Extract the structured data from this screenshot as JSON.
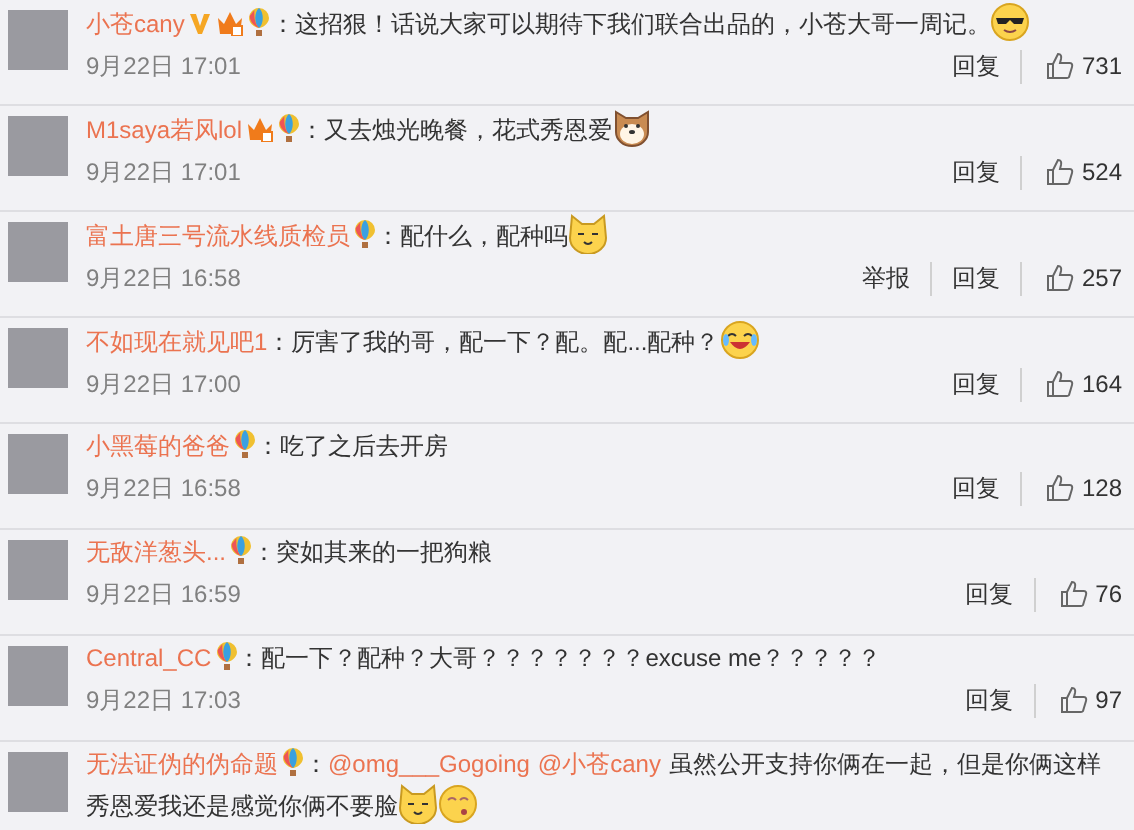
{
  "comments": [
    {
      "name": "小苍cany",
      "badges": [
        {
          "kind": "verified"
        },
        {
          "kind": "vip"
        },
        {
          "kind": "balloon"
        }
      ],
      "content": [
        {
          "kind": "plain",
          "text": "：这招狠！话说大家可以期待下我们联合出品的，小苍大哥一周记。"
        }
      ],
      "emojis": [
        {
          "kind": "cool"
        }
      ],
      "time": "9月22日 17:01",
      "actions": [
        "回复"
      ],
      "likes": "731"
    },
    {
      "name": "M1saya若风lol",
      "badges": [
        {
          "kind": "vip"
        },
        {
          "kind": "balloon"
        }
      ],
      "content": [
        {
          "kind": "plain",
          "text": "：又去烛光晚餐，花式秀恩爱"
        }
      ],
      "emojis": [
        {
          "kind": "dog"
        }
      ],
      "time": "9月22日 17:01",
      "actions": [
        "回复"
      ],
      "likes": "524"
    },
    {
      "name": "富土唐三号流水线质检员",
      "badges": [
        {
          "kind": "balloon"
        }
      ],
      "content": [
        {
          "kind": "plain",
          "text": "：配什么，配种吗"
        }
      ],
      "emojis": [
        {
          "kind": "cat"
        }
      ],
      "time": "9月22日 16:58",
      "actions": [
        "举报",
        "回复"
      ],
      "likes": "257"
    },
    {
      "name": "不如现在就见吧1",
      "content": [
        {
          "kind": "plain",
          "text": "：厉害了我的哥，配一下？配。配...配种？"
        }
      ],
      "emojis": [
        {
          "kind": "laugh"
        }
      ],
      "time": "9月22日 17:00",
      "actions": [
        "回复"
      ],
      "likes": "164"
    },
    {
      "name": "小黑莓的爸爸",
      "badges": [
        {
          "kind": "balloon"
        }
      ],
      "content": [
        {
          "kind": "plain",
          "text": "：吃了之后去开房"
        }
      ],
      "time": "9月22日 16:58",
      "actions": [
        "回复"
      ],
      "likes": "128"
    },
    {
      "name": "无敌洋葱头...",
      "badges": [
        {
          "kind": "balloon"
        }
      ],
      "content": [
        {
          "kind": "plain",
          "text": "：突如其来的一把狗粮"
        }
      ],
      "time": "9月22日 16:59",
      "actions": [
        "回复"
      ],
      "likes": "76"
    },
    {
      "name": "Central_CC",
      "badges": [
        {
          "kind": "balloon"
        }
      ],
      "content": [
        {
          "kind": "plain",
          "text": "：配一下？配种？大哥？？？？？？？excuse me？？？？？"
        }
      ],
      "time": "9月22日 17:03",
      "actions": [
        "回复"
      ],
      "likes": "97"
    },
    {
      "name": "无法证伪的伪命题",
      "badges": [
        {
          "kind": "balloon"
        }
      ],
      "content": [
        {
          "kind": "plain",
          "text": "："
        },
        {
          "kind": "mention",
          "text": "@omg___Gogoing"
        },
        {
          "kind": "mention",
          "text": "@小苍cany"
        },
        {
          "kind": "plain",
          "text": "虽然公开支持你俩在一起，但是你俩这样"
        },
        {
          "kind": "line",
          "text": "秀恩爱我还是感觉你俩不要脸"
        }
      ],
      "emojis": [
        {
          "kind": "cat"
        },
        {
          "kind": "blush"
        }
      ]
    }
  ]
}
